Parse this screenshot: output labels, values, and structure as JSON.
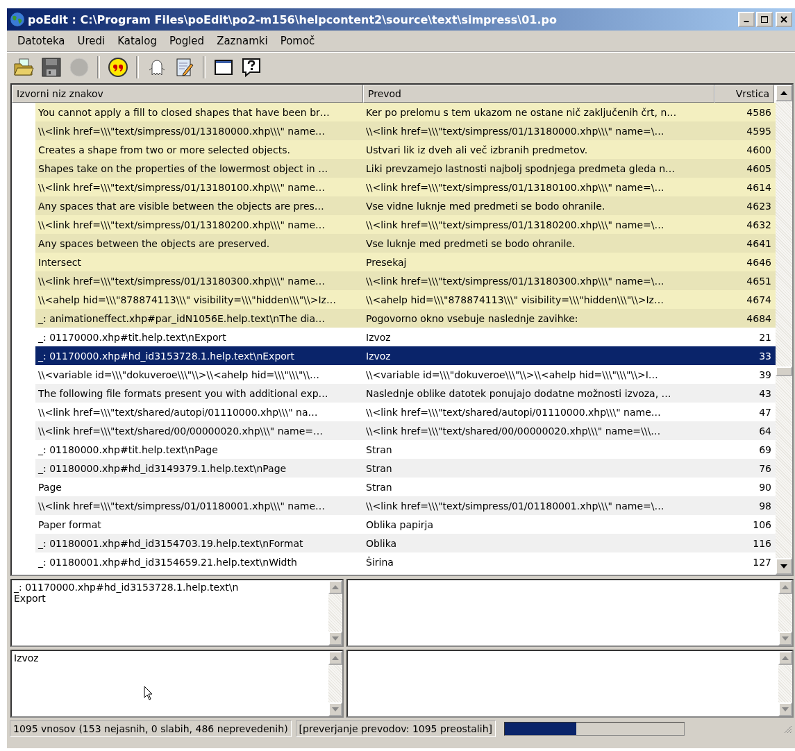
{
  "window": {
    "title": "poEdit : C:\\Program Files\\poEdit\\po2-m156\\helpcontent2\\source\\text\\simpress\\01.po"
  },
  "menu": [
    "Datoteka",
    "Uredi",
    "Katalog",
    "Pogled",
    "Zaznamki",
    "Pomoč"
  ],
  "toolbar": [
    {
      "kind": "open",
      "disabled": false
    },
    {
      "kind": "save",
      "disabled": false
    },
    {
      "kind": "circle",
      "disabled": true
    },
    {
      "kind": "sep"
    },
    {
      "kind": "quote",
      "disabled": false
    },
    {
      "kind": "sep"
    },
    {
      "kind": "ghost",
      "disabled": false
    },
    {
      "kind": "notepad",
      "disabled": false
    },
    {
      "kind": "sep"
    },
    {
      "kind": "window",
      "disabled": false
    },
    {
      "kind": "help",
      "disabled": false
    }
  ],
  "table": {
    "columns": [
      "Izvorni niz znakov",
      "Prevod",
      "Vrstica"
    ],
    "rows": [
      {
        "source": "You cannot apply a fill to closed shapes that have been br…",
        "translation": "Ker po prelomu s tem ukazom ne ostane nič zaključenih črt, n…",
        "line": "4586",
        "fuzzy": true,
        "selected": false
      },
      {
        "source": "\\\\<link href=\\\\\\\"text/simpress/01/13180000.xhp\\\\\\\" name…",
        "translation": "\\\\<link href=\\\\\\\"text/simpress/01/13180000.xhp\\\\\\\" name=\\…",
        "line": "4595",
        "fuzzy": true,
        "selected": false
      },
      {
        "source": "Creates a shape from two or more selected objects.",
        "translation": "Ustvari lik iz dveh ali več izbranih predmetov.",
        "line": "4600",
        "fuzzy": true,
        "selected": false
      },
      {
        "source": "Shapes take on the properties of the lowermost object in …",
        "translation": "Liki prevzamejo lastnosti najbolj spodnjega predmeta gleda n…",
        "line": "4605",
        "fuzzy": true,
        "selected": false
      },
      {
        "source": "\\\\<link href=\\\\\\\"text/simpress/01/13180100.xhp\\\\\\\" name…",
        "translation": "\\\\<link href=\\\\\\\"text/simpress/01/13180100.xhp\\\\\\\" name=\\…",
        "line": "4614",
        "fuzzy": true,
        "selected": false
      },
      {
        "source": "Any spaces that are visible between the objects are pres…",
        "translation": "Vse vidne luknje med predmeti se bodo ohranile.",
        "line": "4623",
        "fuzzy": true,
        "selected": false
      },
      {
        "source": "\\\\<link href=\\\\\\\"text/simpress/01/13180200.xhp\\\\\\\" name…",
        "translation": "\\\\<link href=\\\\\\\"text/simpress/01/13180200.xhp\\\\\\\" name=\\…",
        "line": "4632",
        "fuzzy": true,
        "selected": false
      },
      {
        "source": "Any spaces between the objects are preserved.",
        "translation": "Vse luknje med predmeti se bodo ohranile.",
        "line": "4641",
        "fuzzy": true,
        "selected": false
      },
      {
        "source": "Intersect",
        "translation": "Presekaj",
        "line": "4646",
        "fuzzy": true,
        "selected": false
      },
      {
        "source": "\\\\<link href=\\\\\\\"text/simpress/01/13180300.xhp\\\\\\\" name…",
        "translation": "\\\\<link href=\\\\\\\"text/simpress/01/13180300.xhp\\\\\\\" name=\\…",
        "line": "4651",
        "fuzzy": true,
        "selected": false
      },
      {
        "source": "\\\\<ahelp hid=\\\\\\\"878874113\\\\\\\" visibility=\\\\\\\"hidden\\\\\\\"\\\\>Iz…",
        "translation": "\\\\<ahelp hid=\\\\\\\"878874113\\\\\\\" visibility=\\\\\\\"hidden\\\\\\\"\\\\>Iz…",
        "line": "4674",
        "fuzzy": true,
        "selected": false
      },
      {
        "source": "_: animationeffect.xhp#par_idN1056E.help.text\\nThe dia…",
        "translation": "Pogovorno okno vsebuje naslednje zavihke:",
        "line": "4684",
        "fuzzy": true,
        "selected": false
      },
      {
        "source": "_: 01170000.xhp#tit.help.text\\nExport",
        "translation": "Izvoz",
        "line": "21",
        "fuzzy": false,
        "selected": false
      },
      {
        "source": "_: 01170000.xhp#hd_id3153728.1.help.text\\nExport",
        "translation": "Izvoz",
        "line": "33",
        "fuzzy": false,
        "selected": true
      },
      {
        "source": "\\\\<variable id=\\\\\\\"dokuveroe\\\\\\\"\\\\>\\\\<ahelp hid=\\\\\\\"\\\\\\\"\\\\…",
        "translation": "\\\\<variable id=\\\\\\\"dokuveroe\\\\\\\"\\\\>\\\\<ahelp hid=\\\\\\\"\\\\\\\"\\\\>I…",
        "line": "39",
        "fuzzy": false,
        "selected": false
      },
      {
        "source": "The following file formats present you with additional exp…",
        "translation": "Naslednje oblike datotek ponujajo dodatne možnosti izvoza, …",
        "line": "43",
        "fuzzy": false,
        "selected": false
      },
      {
        "source": "\\\\<link href=\\\\\\\"text/shared/autopi/01110000.xhp\\\\\\\" na…",
        "translation": "\\\\<link href=\\\\\\\"text/shared/autopi/01110000.xhp\\\\\\\" name…",
        "line": "47",
        "fuzzy": false,
        "selected": false
      },
      {
        "source": "\\\\<link href=\\\\\\\"text/shared/00/00000020.xhp\\\\\\\" name=…",
        "translation": "\\\\<link href=\\\\\\\"text/shared/00/00000020.xhp\\\\\\\" name=\\\\\\…",
        "line": "64",
        "fuzzy": false,
        "selected": false
      },
      {
        "source": "_: 01180000.xhp#tit.help.text\\nPage",
        "translation": "Stran",
        "line": "69",
        "fuzzy": false,
        "selected": false
      },
      {
        "source": "_: 01180000.xhp#hd_id3149379.1.help.text\\nPage",
        "translation": "Stran",
        "line": "76",
        "fuzzy": false,
        "selected": false
      },
      {
        "source": "Page",
        "translation": "Stran",
        "line": "90",
        "fuzzy": false,
        "selected": false
      },
      {
        "source": "\\\\<link href=\\\\\\\"text/simpress/01/01180001.xhp\\\\\\\" name…",
        "translation": "\\\\<link href=\\\\\\\"text/simpress/01/01180001.xhp\\\\\\\" name=\\…",
        "line": "98",
        "fuzzy": false,
        "selected": false
      },
      {
        "source": "Paper format",
        "translation": "Oblika papirja",
        "line": "106",
        "fuzzy": false,
        "selected": false
      },
      {
        "source": "_: 01180001.xhp#hd_id3154703.19.help.text\\nFormat",
        "translation": "Oblika",
        "line": "116",
        "fuzzy": false,
        "selected": false
      },
      {
        "source": "_: 01180001.xhp#hd_id3154659.21.help.text\\nWidth",
        "translation": "Širina",
        "line": "127",
        "fuzzy": false,
        "selected": false
      }
    ]
  },
  "source_pane": {
    "lines": [
      "_: 01170000.xhp#hd_id3153728.1.help.text\\n",
      "Export"
    ]
  },
  "translation_pane": {
    "value": "Izvoz"
  },
  "status_bar": {
    "entries": "1095 vnosov (153 nejasnih, 0 slabih, 486 neprevedenih)",
    "check": "[preverjanje prevodov: 1095 preostalih]",
    "level": 0.4
  }
}
